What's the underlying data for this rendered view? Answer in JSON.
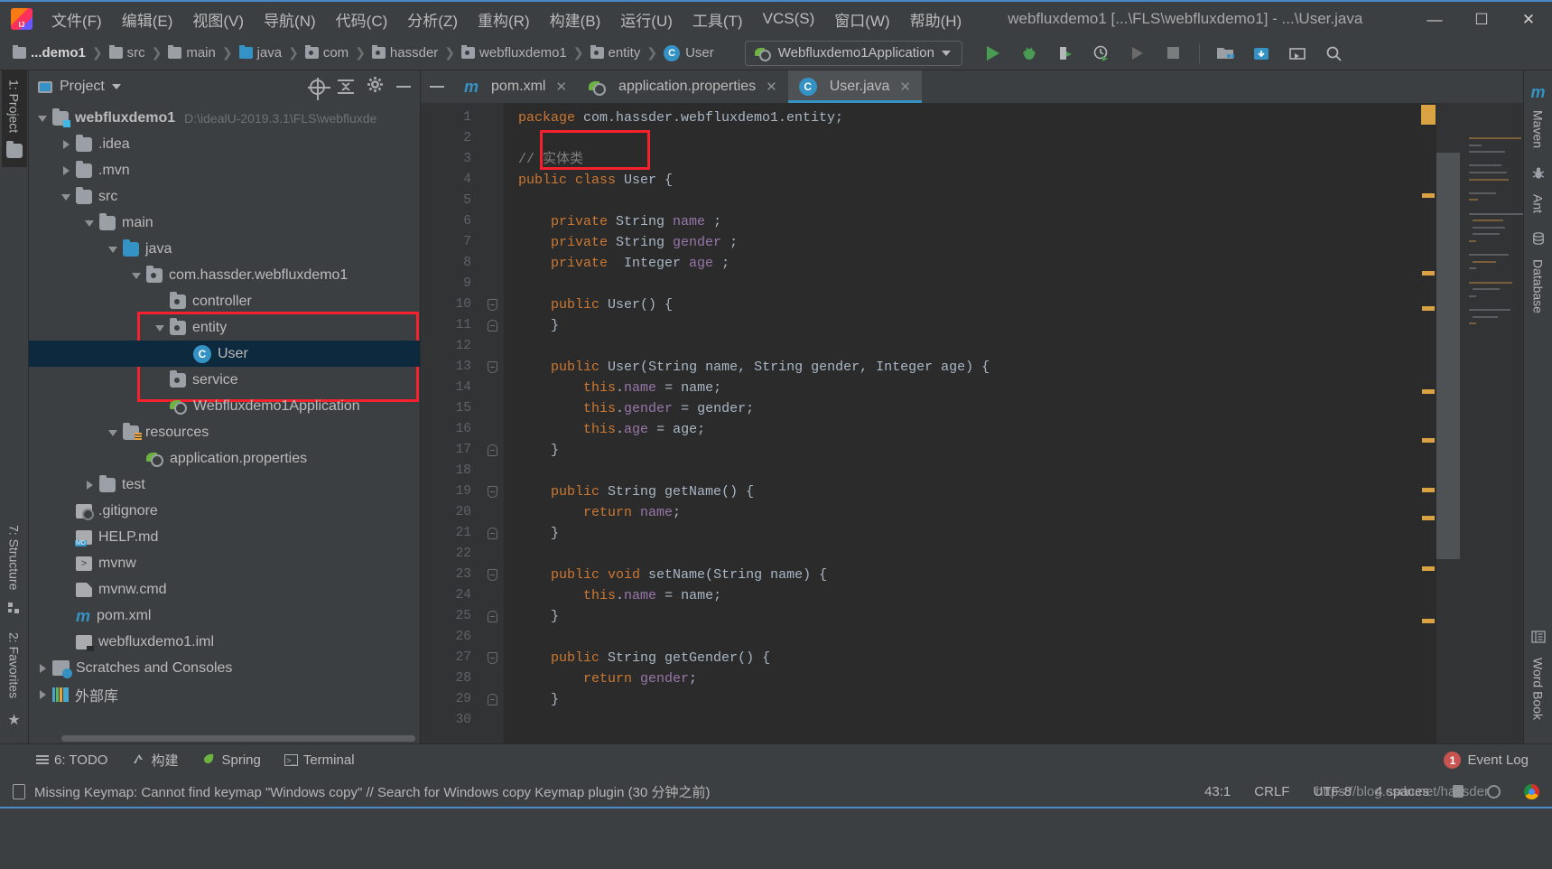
{
  "titlebar": {
    "app_icon": "intellij-logo",
    "menus": [
      "文件(F)",
      "编辑(E)",
      "视图(V)",
      "导航(N)",
      "代码(C)",
      "分析(Z)",
      "重构(R)",
      "构建(B)",
      "运行(U)",
      "工具(T)",
      "VCS(S)",
      "窗口(W)",
      "帮助(H)"
    ],
    "title": "webfluxdemo1 [...\\FLS\\webfluxdemo1] - ...\\User.java",
    "minimize": "—",
    "maximize": "☐",
    "close": "✕"
  },
  "navbar": {
    "breadcrumbs": [
      {
        "label": "...demo1",
        "icon": "project-icon",
        "bold": true
      },
      {
        "label": "src",
        "icon": "folder-grey"
      },
      {
        "label": "main",
        "icon": "folder-grey"
      },
      {
        "label": "java",
        "icon": "folder-blue"
      },
      {
        "label": "com",
        "icon": "package-icon"
      },
      {
        "label": "hassder",
        "icon": "package-icon"
      },
      {
        "label": "webfluxdemo1",
        "icon": "package-icon"
      },
      {
        "label": "entity",
        "icon": "package-icon"
      },
      {
        "label": "User",
        "icon": "class-icon",
        "badge": "C"
      }
    ],
    "separator": "❯",
    "run_config": {
      "name": "Webfluxdemo1Application",
      "icon": "spring-boot-icon",
      "caret": "▼"
    },
    "buttons": [
      {
        "name": "run-button",
        "icon": "play-triangle"
      },
      {
        "name": "debug-button",
        "icon": "bug-icon"
      },
      {
        "name": "run-with-coverage-button",
        "icon": "coverage-icon"
      },
      {
        "name": "profiler-button",
        "icon": "clock-run-icon"
      },
      {
        "name": "rerun-button",
        "icon": "play-triangle-grey"
      },
      {
        "name": "stop-button",
        "icon": "stop-square"
      },
      {
        "name": "project-structure-button",
        "icon": "project-structure-icon"
      },
      {
        "name": "update-project-button",
        "icon": "vcs-update-icon"
      },
      {
        "name": "screenshot-button",
        "icon": "screenshot-icon"
      },
      {
        "name": "search-everywhere-button",
        "icon": "search-icon"
      }
    ]
  },
  "left_tool_strip": [
    {
      "label": "1: Project",
      "key": "1",
      "icon": "project-folder-icon",
      "active": true
    },
    {
      "label": "7: Structure",
      "key": "7",
      "icon": "structure-icon",
      "active": false
    },
    {
      "label": "2: Favorites",
      "key": "2",
      "icon": "star-icon",
      "active": false
    }
  ],
  "right_tool_strip": [
    {
      "label": "Maven",
      "icon": "maven-m-icon"
    },
    {
      "label": "Ant",
      "icon": "ant-icon"
    },
    {
      "label": "Database",
      "icon": "database-icon"
    },
    {
      "label": "Word Book",
      "icon": "word-book-icon"
    }
  ],
  "project_panel": {
    "title": "Project",
    "title_caret": "▼",
    "tools": [
      {
        "name": "select-opened-file-button",
        "icon": "crosshair-icon"
      },
      {
        "name": "collapse-all-button",
        "icon": "collapse-all-icon"
      },
      {
        "name": "settings-button",
        "icon": "gear-icon"
      },
      {
        "name": "hide-button",
        "icon": "minimize-icon"
      }
    ],
    "tree": [
      {
        "label": "webfluxdemo1",
        "path": "D:\\idealU-2019.3.1\\FLS\\webfluxde",
        "indent": 0,
        "twist": "down",
        "icon": "module-folder",
        "bold": true
      },
      {
        "label": ".idea",
        "indent": 1,
        "twist": "right",
        "icon": "folder"
      },
      {
        "label": ".mvn",
        "indent": 1,
        "twist": "right",
        "icon": "folder"
      },
      {
        "label": "src",
        "indent": 1,
        "twist": "down",
        "icon": "folder"
      },
      {
        "label": "main",
        "indent": 2,
        "twist": "down",
        "icon": "folder"
      },
      {
        "label": "java",
        "indent": 3,
        "twist": "down",
        "icon": "folder-blue"
      },
      {
        "label": "com.hassder.webfluxdemo1",
        "indent": 4,
        "twist": "down",
        "icon": "package"
      },
      {
        "label": "controller",
        "indent": 5,
        "twist": "none",
        "icon": "package"
      },
      {
        "label": "entity",
        "indent": 5,
        "twist": "down",
        "icon": "package"
      },
      {
        "label": "User",
        "indent": 6,
        "twist": "none",
        "icon": "class",
        "selected": true
      },
      {
        "label": "service",
        "indent": 5,
        "twist": "none",
        "icon": "package"
      },
      {
        "label": "Webfluxdemo1Application",
        "indent": 5,
        "twist": "none",
        "icon": "spring-class"
      },
      {
        "label": "resources",
        "indent": 3,
        "twist": "down",
        "icon": "folder-resources"
      },
      {
        "label": "application.properties",
        "indent": 4,
        "twist": "none",
        "icon": "spring-properties"
      },
      {
        "label": "test",
        "indent": 2,
        "twist": "right",
        "icon": "folder"
      },
      {
        "label": ".gitignore",
        "indent": 1,
        "twist": "none",
        "icon": "gitignore"
      },
      {
        "label": "HELP.md",
        "indent": 1,
        "twist": "none",
        "icon": "markdown"
      },
      {
        "label": "mvnw",
        "indent": 1,
        "twist": "none",
        "icon": "shell"
      },
      {
        "label": "mvnw.cmd",
        "indent": 1,
        "twist": "none",
        "icon": "doc"
      },
      {
        "label": "pom.xml",
        "indent": 1,
        "twist": "none",
        "icon": "maven"
      },
      {
        "label": "webfluxdemo1.iml",
        "indent": 1,
        "twist": "none",
        "icon": "iml"
      },
      {
        "label": "Scratches and Consoles",
        "indent": 0,
        "twist": "right",
        "icon": "scratches"
      },
      {
        "label": "外部库",
        "indent": 0,
        "twist": "right",
        "icon": "library"
      }
    ],
    "highlight_boxes": [
      {
        "name": "package-highlight",
        "desc": "red box around controller / entity / User / service"
      }
    ]
  },
  "editor": {
    "tabs": [
      {
        "label": "pom.xml",
        "icon": "maven-icon",
        "close": "✕",
        "active": false
      },
      {
        "label": "application.properties",
        "icon": "spring-icon",
        "close": "✕",
        "active": false
      },
      {
        "label": "User.java",
        "icon": "class-icon",
        "badge": "C",
        "close": "✕",
        "active": true
      }
    ],
    "first_line": 1,
    "last_line": 30,
    "lines": [
      {
        "n": 1,
        "tokens": [
          {
            "t": "package ",
            "c": "kw"
          },
          {
            "t": "com.hassder.webfluxdemo1.entity;",
            "c": "pl"
          }
        ]
      },
      {
        "n": 2,
        "tokens": []
      },
      {
        "n": 3,
        "tokens": [
          {
            "t": "// 实体类",
            "c": "cm"
          }
        ],
        "highlighted": true
      },
      {
        "n": 4,
        "tokens": [
          {
            "t": "public class ",
            "c": "kw"
          },
          {
            "t": "User ",
            "c": "ty"
          },
          {
            "t": "{",
            "c": "pl"
          }
        ]
      },
      {
        "n": 5,
        "tokens": []
      },
      {
        "n": 6,
        "tokens": [
          {
            "t": "    private ",
            "c": "kw"
          },
          {
            "t": "String ",
            "c": "ty"
          },
          {
            "t": "name ",
            "c": "fld"
          },
          {
            "t": ";",
            "c": "pl"
          }
        ]
      },
      {
        "n": 7,
        "tokens": [
          {
            "t": "    private ",
            "c": "kw"
          },
          {
            "t": "String ",
            "c": "ty"
          },
          {
            "t": "gender ",
            "c": "fld"
          },
          {
            "t": ";",
            "c": "pl"
          }
        ]
      },
      {
        "n": 8,
        "tokens": [
          {
            "t": "    private  ",
            "c": "kw"
          },
          {
            "t": "Integer ",
            "c": "ty"
          },
          {
            "t": "age ",
            "c": "fld"
          },
          {
            "t": ";",
            "c": "pl"
          }
        ]
      },
      {
        "n": 9,
        "tokens": []
      },
      {
        "n": 10,
        "tokens": [
          {
            "t": "    public ",
            "c": "kw"
          },
          {
            "t": "User",
            "c": "ty"
          },
          {
            "t": "() {",
            "c": "pl"
          }
        ],
        "fold": "down"
      },
      {
        "n": 11,
        "tokens": [
          {
            "t": "    }",
            "c": "pl"
          }
        ],
        "fold": "up"
      },
      {
        "n": 12,
        "tokens": []
      },
      {
        "n": 13,
        "tokens": [
          {
            "t": "    public ",
            "c": "kw"
          },
          {
            "t": "User",
            "c": "ty"
          },
          {
            "t": "(",
            "c": "pl"
          },
          {
            "t": "String ",
            "c": "ty"
          },
          {
            "t": "name, ",
            "c": "pl"
          },
          {
            "t": "String ",
            "c": "ty"
          },
          {
            "t": "gender, ",
            "c": "pl"
          },
          {
            "t": "Integer ",
            "c": "ty"
          },
          {
            "t": "age) {",
            "c": "pl"
          }
        ],
        "fold": "down"
      },
      {
        "n": 14,
        "tokens": [
          {
            "t": "        this",
            "c": "kw"
          },
          {
            "t": ".",
            "c": "pl"
          },
          {
            "t": "name",
            "c": "fld"
          },
          {
            "t": " = name;",
            "c": "pl"
          }
        ]
      },
      {
        "n": 15,
        "tokens": [
          {
            "t": "        this",
            "c": "kw"
          },
          {
            "t": ".",
            "c": "pl"
          },
          {
            "t": "gender",
            "c": "fld"
          },
          {
            "t": " = gender;",
            "c": "pl"
          }
        ]
      },
      {
        "n": 16,
        "tokens": [
          {
            "t": "        this",
            "c": "kw"
          },
          {
            "t": ".",
            "c": "pl"
          },
          {
            "t": "age",
            "c": "fld"
          },
          {
            "t": " = age;",
            "c": "pl"
          }
        ]
      },
      {
        "n": 17,
        "tokens": [
          {
            "t": "    }",
            "c": "pl"
          }
        ],
        "fold": "up"
      },
      {
        "n": 18,
        "tokens": []
      },
      {
        "n": 19,
        "tokens": [
          {
            "t": "    public ",
            "c": "kw"
          },
          {
            "t": "String ",
            "c": "ty"
          },
          {
            "t": "getName",
            "c": "mth"
          },
          {
            "t": "() {",
            "c": "pl"
          }
        ],
        "fold": "down"
      },
      {
        "n": 20,
        "tokens": [
          {
            "t": "        return ",
            "c": "kw"
          },
          {
            "t": "name",
            "c": "fld"
          },
          {
            "t": ";",
            "c": "pl"
          }
        ]
      },
      {
        "n": 21,
        "tokens": [
          {
            "t": "    }",
            "c": "pl"
          }
        ],
        "fold": "up"
      },
      {
        "n": 22,
        "tokens": []
      },
      {
        "n": 23,
        "tokens": [
          {
            "t": "    public void ",
            "c": "kw"
          },
          {
            "t": "setName",
            "c": "mth"
          },
          {
            "t": "(",
            "c": "pl"
          },
          {
            "t": "String ",
            "c": "ty"
          },
          {
            "t": "name) {",
            "c": "pl"
          }
        ],
        "fold": "down"
      },
      {
        "n": 24,
        "tokens": [
          {
            "t": "        this",
            "c": "kw"
          },
          {
            "t": ".",
            "c": "pl"
          },
          {
            "t": "name",
            "c": "fld"
          },
          {
            "t": " = name;",
            "c": "pl"
          }
        ]
      },
      {
        "n": 25,
        "tokens": [
          {
            "t": "    }",
            "c": "pl"
          }
        ],
        "fold": "up"
      },
      {
        "n": 26,
        "tokens": []
      },
      {
        "n": 27,
        "tokens": [
          {
            "t": "    public ",
            "c": "kw"
          },
          {
            "t": "String ",
            "c": "ty"
          },
          {
            "t": "getGender",
            "c": "mth"
          },
          {
            "t": "() {",
            "c": "pl"
          }
        ],
        "fold": "down"
      },
      {
        "n": 28,
        "tokens": [
          {
            "t": "        return ",
            "c": "kw"
          },
          {
            "t": "gender",
            "c": "fld"
          },
          {
            "t": ";",
            "c": "pl"
          }
        ]
      },
      {
        "n": 29,
        "tokens": [
          {
            "t": "    }",
            "c": "pl"
          }
        ],
        "fold": "up"
      },
      {
        "n": 30,
        "tokens": []
      }
    ],
    "comment_highlight": "// 实体类"
  },
  "bottom_bar": {
    "items": [
      {
        "label": "6: TODO",
        "key": "6",
        "icon": "todo-icon"
      },
      {
        "label": "构建",
        "icon": "build-icon"
      },
      {
        "label": "Spring",
        "icon": "spring-icon"
      },
      {
        "label": "Terminal",
        "icon": "terminal-icon"
      }
    ],
    "event_log": {
      "label": "Event Log",
      "count": "1"
    }
  },
  "status_bar": {
    "message": "Missing Keymap: Cannot find keymap \"Windows copy\" // Search for Windows copy Keymap plugin (30 分钟之前)",
    "caret_position": "43:1",
    "line_separator": "CRLF",
    "encoding": "UTF-8",
    "indent": "4 spaces",
    "icons": [
      {
        "name": "lock-icon"
      },
      {
        "name": "inspection-face-icon"
      },
      {
        "name": "chrome-icon"
      }
    ]
  },
  "watermark": "https://blog.csdn.net/hassder",
  "colors": {
    "accent_blue": "#3592c4",
    "titlebar_line": "#4a88c7",
    "panel_bg": "#3c3f41",
    "editor_bg": "#2b2b2b",
    "gutter_bg": "#313335",
    "selection_bg": "#0d293e",
    "highlight_red": "#f5222d",
    "keyword_orange": "#cc7832",
    "field_purple": "#9876aa",
    "comment_grey": "#808080",
    "marker_yellow": "#d9a343",
    "green_run": "#499c54",
    "badge_red": "#c75450"
  }
}
